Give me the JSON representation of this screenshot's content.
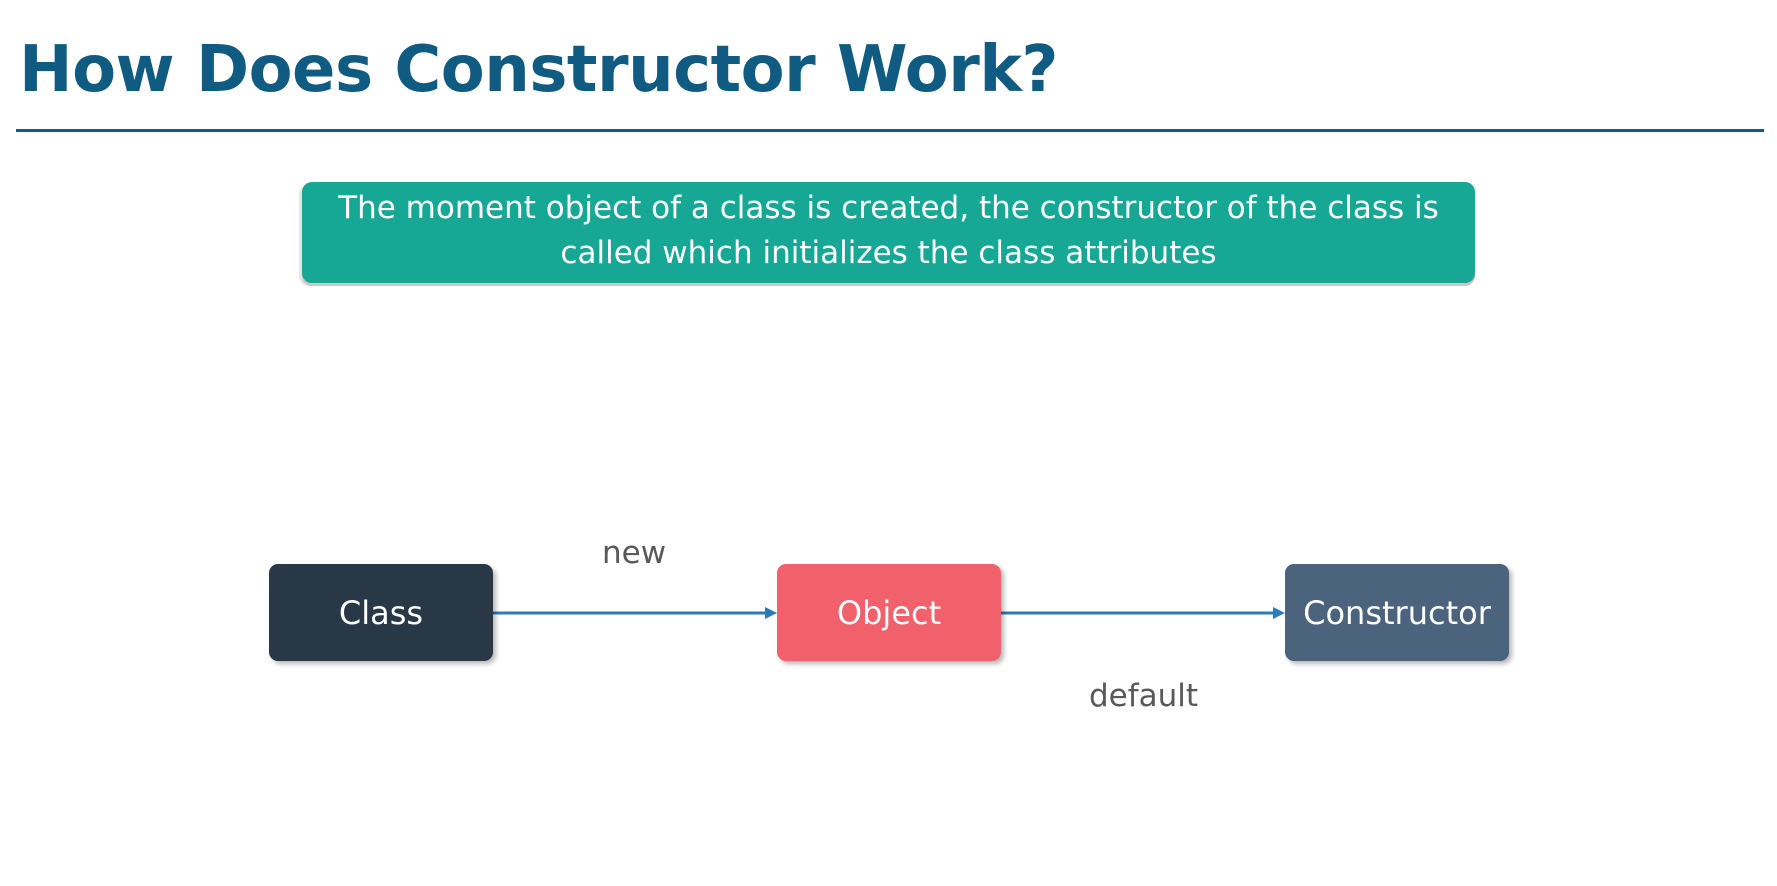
{
  "slide": {
    "title": "How Does Constructor Work?"
  },
  "callout": {
    "line1": "The moment object of a class is created, the constructor of the class is",
    "line2": "called which initializes the class attributes"
  },
  "diagram": {
    "nodes": {
      "class": {
        "label": "Class",
        "color": "#293846"
      },
      "object": {
        "label": "Object",
        "color": "#f0616b"
      },
      "constructor": {
        "label": "Constructor",
        "color": "#4b637c"
      }
    },
    "edges": {
      "class_to_object": {
        "label": "new"
      },
      "object_to_constructor": {
        "label": "default"
      }
    },
    "arrow_color": "#2e7cb6"
  }
}
